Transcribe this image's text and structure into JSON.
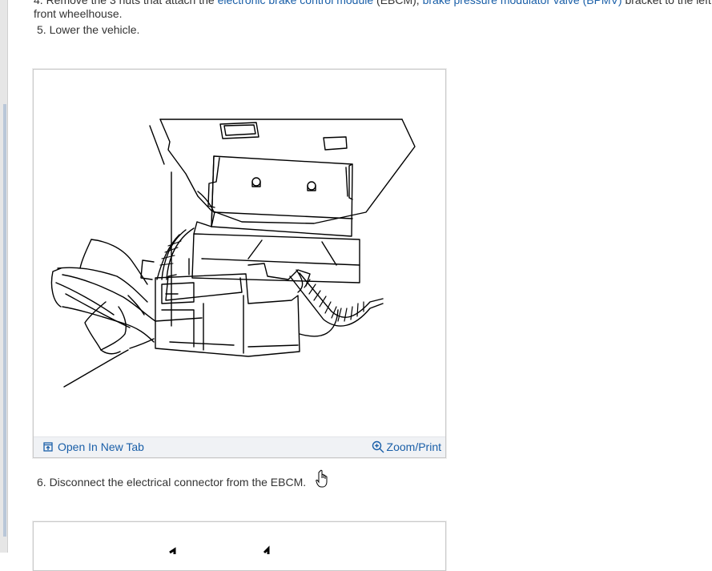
{
  "step4": {
    "prefix": "4. Remove the 3 nuts that attach the ",
    "link1": "electronic brake control module",
    "mid": " (EBCM), ",
    "link2": "brake pressure modulator valve (BPMV)",
    "suffix": " bracket to the left",
    "line2": "front wheelhouse."
  },
  "step5": {
    "text": "5. Lower the vehicle."
  },
  "figure1": {
    "open_label": "Open In New Tab",
    "zoom_label": "Zoom/Print"
  },
  "step6": {
    "text": "6. Disconnect the electrical connector from the EBCM."
  },
  "icons": {
    "open": "open-in-new-tab-icon",
    "zoom": "zoom-in-icon",
    "cursor": "hand-pointer-icon"
  },
  "colors": {
    "link": "#1a5fa8",
    "footer_bg": "#f0f2f5",
    "text": "#333333"
  }
}
